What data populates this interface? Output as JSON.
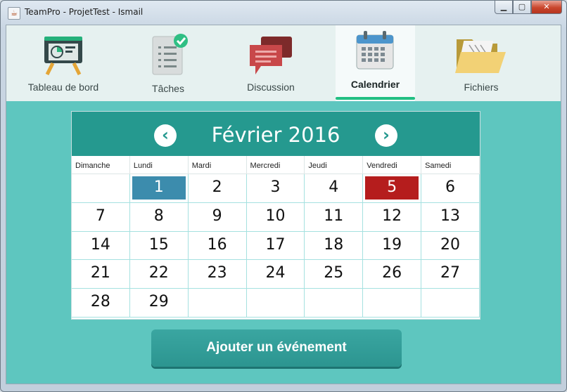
{
  "window": {
    "title": "TeamPro - ProjetTest - Ismail",
    "controls": {
      "minimize": "▁",
      "maximize": "▢",
      "close": "✕"
    }
  },
  "nav": {
    "items": [
      {
        "label": "Tableau de bord",
        "icon": "dashboard-board-icon"
      },
      {
        "label": "Tâches",
        "icon": "task-checklist-icon"
      },
      {
        "label": "Discussion",
        "icon": "chat-bubbles-icon"
      },
      {
        "label": "Calendrier",
        "icon": "calendar-icon",
        "active": true
      },
      {
        "label": "Fichiers",
        "icon": "folder-files-icon"
      }
    ]
  },
  "calendar": {
    "month_label": "Février 2016",
    "prev": "‹",
    "next": "›",
    "weekdays": [
      "Dimanche",
      "Lundi",
      "Mardi",
      "Mercredi",
      "Jeudi",
      "Vendredi",
      "Samedi"
    ],
    "weeks": [
      [
        "",
        "1",
        "2",
        "3",
        "4",
        "5",
        "6"
      ],
      [
        "7",
        "8",
        "9",
        "10",
        "11",
        "12",
        "13"
      ],
      [
        "14",
        "15",
        "16",
        "17",
        "18",
        "19",
        "20"
      ],
      [
        "21",
        "22",
        "23",
        "24",
        "25",
        "26",
        "27"
      ],
      [
        "28",
        "29",
        "",
        "",
        "",
        "",
        ""
      ]
    ],
    "selected_day": "1",
    "today_day": "5"
  },
  "actions": {
    "add_event": "Ajouter un événement"
  },
  "colors": {
    "accent": "#25998f",
    "background": "#5ec6bf",
    "selected": "#3c8cad",
    "today": "#b51d1d",
    "active_tab_underline": "#22bf83"
  }
}
